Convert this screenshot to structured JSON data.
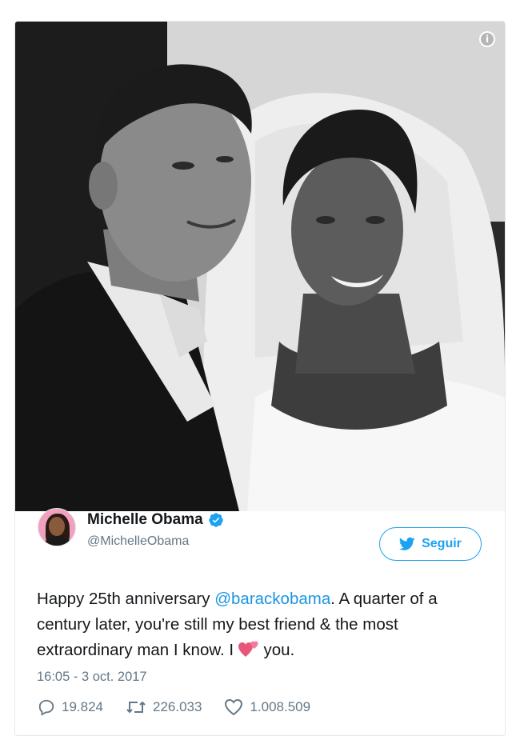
{
  "photo": {
    "alt_icon": "info-icon",
    "info_glyph": "i"
  },
  "author": {
    "display_name": "Michelle Obama",
    "handle": "@MichelleObama",
    "verified": true,
    "avatar_icon": "avatar"
  },
  "follow_button": {
    "label": "Seguir",
    "icon": "twitter-bird-icon",
    "color": "#1da1f2"
  },
  "tweet": {
    "text_before": "Happy 25th anniversary ",
    "mention": "@barackobama",
    "text_after": ". A quarter of a century later, you're still my best friend & the most extraordinary man I know. I ",
    "emoji": "two-hearts-icon",
    "text_end": " you.",
    "timestamp": "16:05 - 3 oct. 2017",
    "mention_color": "#1b95e0"
  },
  "actions": {
    "replies": "19.824",
    "retweets": "226.033",
    "likes": "1.008.509"
  }
}
